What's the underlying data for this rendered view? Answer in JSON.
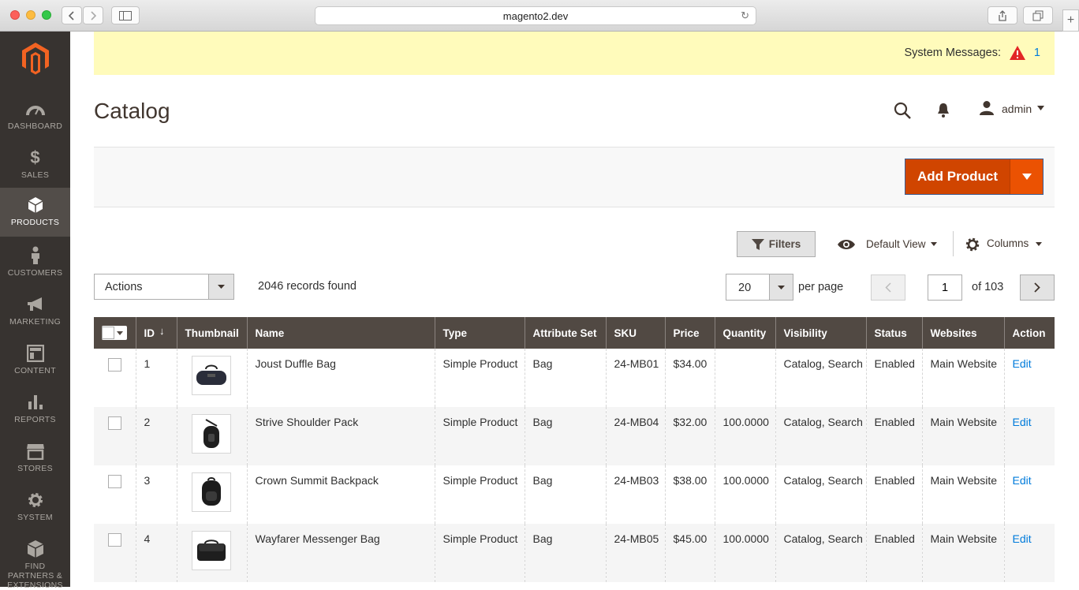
{
  "browser": {
    "url": "magento2.dev"
  },
  "sidebar": {
    "items": [
      {
        "label": "DASHBOARD",
        "icon": "dashboard-icon"
      },
      {
        "label": "SALES",
        "icon": "dollar-icon"
      },
      {
        "label": "PRODUCTS",
        "icon": "cube-icon"
      },
      {
        "label": "CUSTOMERS",
        "icon": "person-icon"
      },
      {
        "label": "MARKETING",
        "icon": "megaphone-icon"
      },
      {
        "label": "CONTENT",
        "icon": "layout-icon"
      },
      {
        "label": "REPORTS",
        "icon": "bar-chart-icon"
      },
      {
        "label": "STORES",
        "icon": "storefront-icon"
      },
      {
        "label": "SYSTEM",
        "icon": "gear-icon"
      },
      {
        "label": "FIND PARTNERS & EXTENSIONS",
        "icon": "blocks-icon"
      }
    ]
  },
  "notice": {
    "label": "System Messages:",
    "count": "1"
  },
  "header": {
    "title": "Catalog",
    "user": "admin"
  },
  "toolbar": {
    "add_product": "Add Product",
    "filters": "Filters",
    "view": "Default View",
    "columns": "Columns",
    "actions": "Actions",
    "records": "2046 records found",
    "per_page_value": "20",
    "per_page_label": "per page",
    "page": "1",
    "of_pages": "of 103"
  },
  "table": {
    "headers": [
      "ID",
      "Thumbnail",
      "Name",
      "Type",
      "Attribute Set",
      "SKU",
      "Price",
      "Quantity",
      "Visibility",
      "Status",
      "Websites",
      "Action"
    ],
    "rows": [
      {
        "id": "1",
        "name": "Joust Duffle Bag",
        "type": "Simple Product",
        "attr": "Bag",
        "sku": "24-MB01",
        "price": "$34.00",
        "qty": "",
        "vis": "Catalog, Search",
        "status": "Enabled",
        "web": "Main Website",
        "action": "Edit"
      },
      {
        "id": "2",
        "name": "Strive Shoulder Pack",
        "type": "Simple Product",
        "attr": "Bag",
        "sku": "24-MB04",
        "price": "$32.00",
        "qty": "100.0000",
        "vis": "Catalog, Search",
        "status": "Enabled",
        "web": "Main Website",
        "action": "Edit"
      },
      {
        "id": "3",
        "name": "Crown Summit Backpack",
        "type": "Simple Product",
        "attr": "Bag",
        "sku": "24-MB03",
        "price": "$38.00",
        "qty": "100.0000",
        "vis": "Catalog, Search",
        "status": "Enabled",
        "web": "Main Website",
        "action": "Edit"
      },
      {
        "id": "4",
        "name": "Wayfarer Messenger Bag",
        "type": "Simple Product",
        "attr": "Bag",
        "sku": "24-MB05",
        "price": "$45.00",
        "qty": "100.0000",
        "vis": "Catalog, Search",
        "status": "Enabled",
        "web": "Main Website",
        "action": "Edit"
      }
    ]
  },
  "colors": {
    "accent": "#eb5202",
    "sidebar": "#373330",
    "header": "#514943",
    "link": "#007bdb",
    "notice": "#fffbbb"
  }
}
